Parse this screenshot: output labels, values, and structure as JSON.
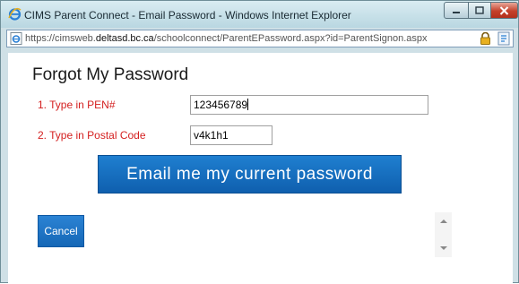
{
  "window": {
    "title": "CIMS Parent Connect - Email Password - Windows Internet Explorer",
    "url_prefix": "https://cimsweb.",
    "url_domain": "deltasd.bc.ca",
    "url_path": "/schoolconnect/ParentEPassword.aspx?id=ParentSignon.aspx"
  },
  "page": {
    "heading": "Forgot My Password",
    "pen_label": "1. Type in PEN#",
    "pen_value": "123456789",
    "postal_label": "2. Type in Postal Code",
    "postal_value": "v4k1h1",
    "email_button": "Email me my current password",
    "cancel_button": "Cancel"
  },
  "icons": {
    "title": "ie-logo-icon",
    "address": "ie-page-icon",
    "security": "lock-icon",
    "compat": "compatibility-view-icon"
  },
  "colors": {
    "label_red": "#d42020",
    "button_blue": "#1a72c4"
  }
}
